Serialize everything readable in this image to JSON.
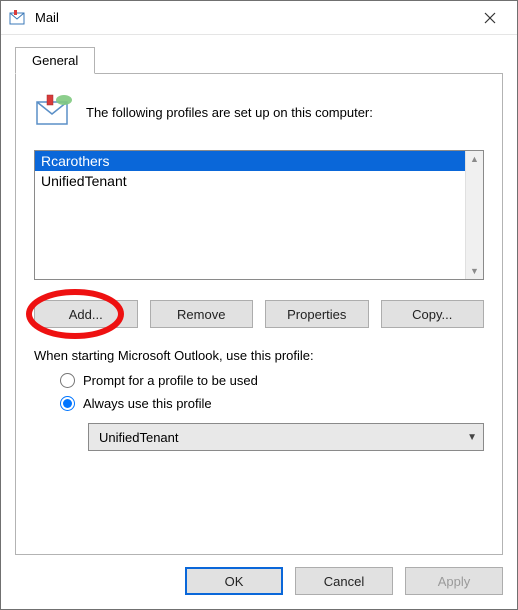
{
  "window": {
    "title": "Mail"
  },
  "tabs": [
    {
      "label": "General"
    }
  ],
  "header": {
    "text": "The following profiles are set up on this computer:"
  },
  "profiles": {
    "items": [
      {
        "name": "Rcarothers",
        "selected": true
      },
      {
        "name": "UnifiedTenant",
        "selected": false
      }
    ]
  },
  "buttons": {
    "add": "Add...",
    "remove": "Remove",
    "properties": "Properties",
    "copy": "Copy..."
  },
  "startup": {
    "label": "When starting Microsoft Outlook, use this profile:",
    "options": {
      "prompt": "Prompt for a profile to be used",
      "always": "Always use this profile"
    },
    "selected": "always",
    "default_profile": "UnifiedTenant"
  },
  "footer": {
    "ok": "OK",
    "cancel": "Cancel",
    "apply": "Apply"
  },
  "annotation": {
    "highlighted_button": "add"
  }
}
